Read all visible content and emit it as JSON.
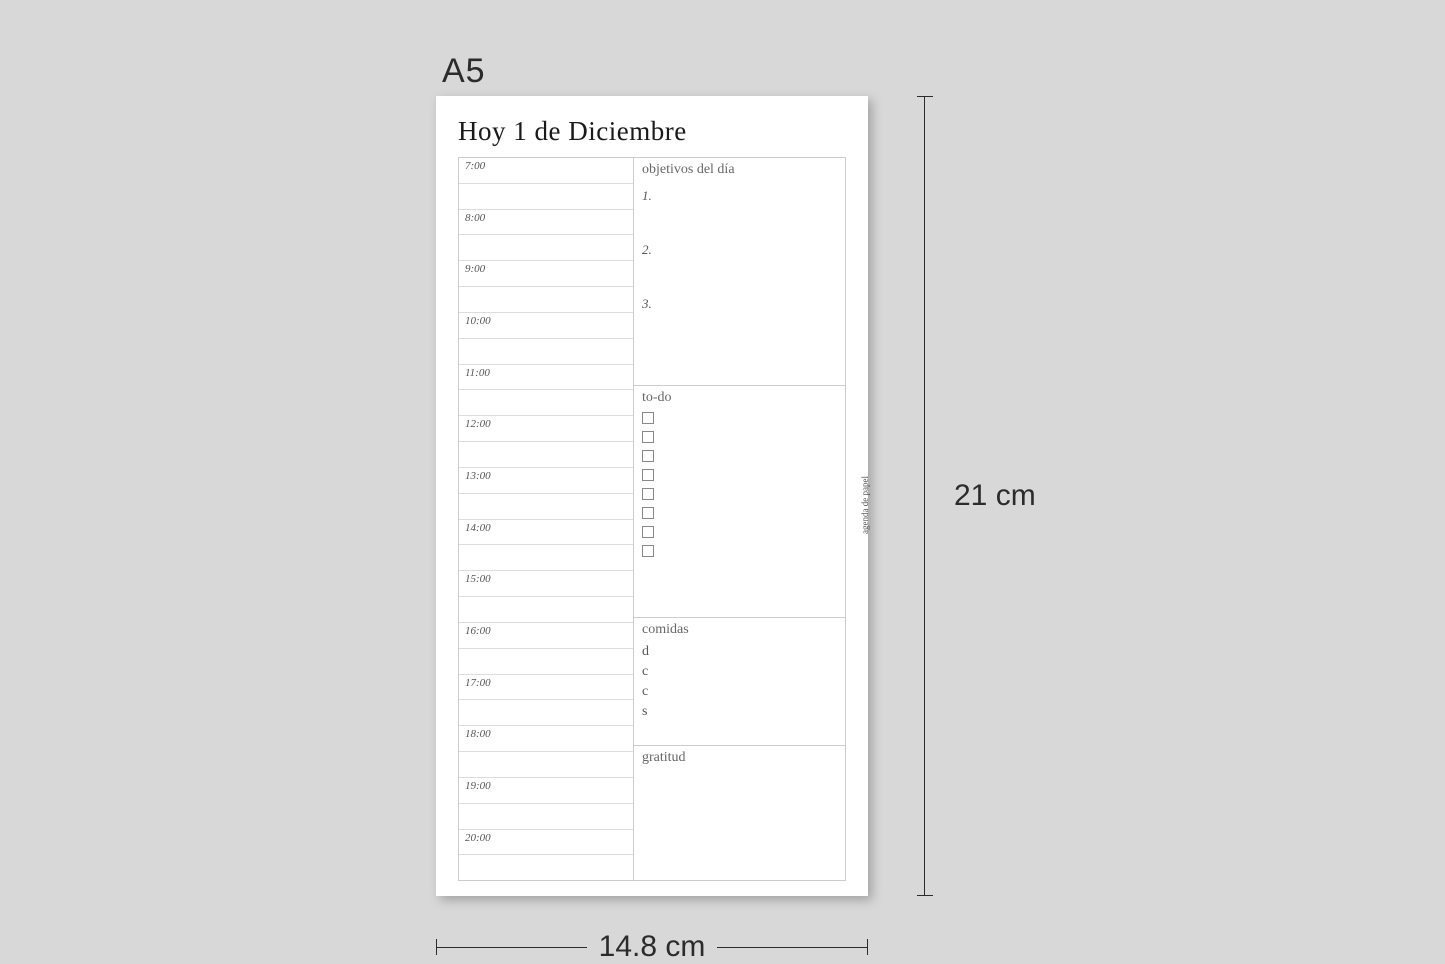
{
  "size_label": "A5",
  "title": "Hoy 1 de Diciembre",
  "watermark": "agenda de papel",
  "schedule_times": [
    "7:00",
    "",
    "8:00",
    "",
    "9:00",
    "",
    "10:00",
    "",
    "11:00",
    "",
    "12:00",
    "",
    "13:00",
    "",
    "14:00",
    "",
    "15:00",
    "",
    "16:00",
    "",
    "17:00",
    "",
    "18:00",
    "",
    "19:00",
    "",
    "20:00",
    ""
  ],
  "sections": {
    "objectives": {
      "title": "objetivos del día",
      "items": [
        "1.",
        "2.",
        "3."
      ]
    },
    "todo": {
      "title": "to-do",
      "count": 8
    },
    "meals": {
      "title": "comidas",
      "lines": [
        "d",
        "c",
        "c",
        "s"
      ]
    },
    "gratitude": {
      "title": "gratitud"
    }
  },
  "dimensions": {
    "width": "14.8 cm",
    "height": "21 cm"
  }
}
